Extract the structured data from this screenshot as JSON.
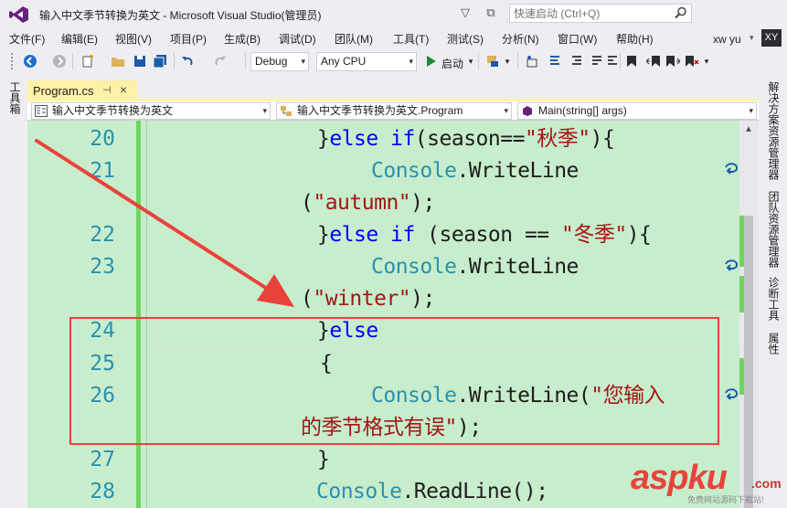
{
  "window": {
    "title": "输入中文季节转换为英文 - Microsoft Visual Studio(管理员)",
    "quick_launch_placeholder": "快速启动 (Ctrl+Q)"
  },
  "menu": [
    "文件(F)",
    "编辑(E)",
    "视图(V)",
    "项目(P)",
    "生成(B)",
    "调试(D)",
    "团队(M)",
    "工具(T)",
    "测试(S)",
    "分析(N)",
    "窗口(W)",
    "帮助(H)"
  ],
  "user": {
    "name": "xw yu",
    "initials": "XY"
  },
  "toolbar": {
    "configuration": "Debug",
    "platform": "Any CPU",
    "run_label": "启动"
  },
  "left_panel": {
    "toolbox": "工具箱"
  },
  "right_panel": [
    "解决方案资源管理器",
    "团队资源管理器",
    "诊断工具",
    "属性"
  ],
  "document": {
    "tab": "Program.cs",
    "pin_glyph": "⊣",
    "close_glyph": "×",
    "nav": {
      "project": "输入中文季节转换为英文",
      "class": "输入中文季节转换为英文.Program",
      "member": "Main(string[] args)"
    }
  },
  "code_lines": [
    {
      "no": "20",
      "text": "}else if(season==\"秋季\"){"
    },
    {
      "no": "21",
      "text": "Console.WriteLine(\"autumn\");"
    },
    {
      "no": "22",
      "text": "}else if (season == \"冬季\"){"
    },
    {
      "no": "23",
      "text": "Console.WriteLine(\"winter\");"
    },
    {
      "no": "24",
      "text": "}else"
    },
    {
      "no": "25",
      "text": "{"
    },
    {
      "no": "26",
      "text": "Console.WriteLine(\"您输入的季节格式有误\");"
    },
    {
      "no": "27",
      "text": "}"
    },
    {
      "no": "28",
      "text": "Console.ReadLine();"
    }
  ],
  "tokens": {
    "l20_a": "}",
    "l20_kw1": "else",
    "l20_kw2": "if",
    "l20_b": "(season==",
    "l20_str": "\"秋季\"",
    "l20_c": "){",
    "l21_ty": "Console",
    "l21_a": ".WriteLine",
    "l21_b": "(",
    "l21_str": "\"autumn\"",
    "l21_c": ");",
    "l22_a": "}",
    "l22_kw1": "else",
    "l22_kw2": "if",
    "l22_b": "(season == ",
    "l22_str": "\"冬季\"",
    "l22_c": "){",
    "l23_ty": "Console",
    "l23_a": ".WriteLine",
    "l23_b": "(",
    "l23_str": "\"winter\"",
    "l23_c": ");",
    "l24_a": "}",
    "l24_kw": "else",
    "l25_a": "{",
    "l26_ty": "Console",
    "l26_a": ".WriteLine(",
    "l26_str1": "\"您输入",
    "l26_str2": "的季节格式有误\"",
    "l26_c": ");",
    "l27_a": "}",
    "l28_ty": "Console",
    "l28_a": ".ReadLine();"
  },
  "colors": {
    "editor_bg": "#c7edcc",
    "keyword": "#0000ff",
    "type": "#2b91af",
    "string": "#a31515",
    "annotation": "#e8433a"
  },
  "watermark": {
    "brand": "aspku",
    "tld": ".com",
    "sub": "免费网站源码下载站!"
  }
}
